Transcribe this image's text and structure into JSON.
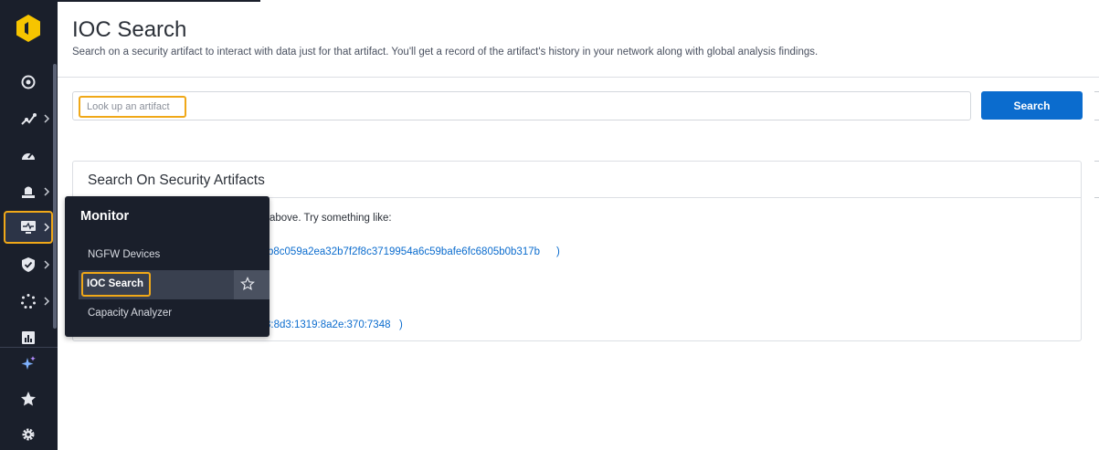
{
  "page": {
    "title": "IOC Search",
    "subtitle": "Search on a security artifact to interact with data just for that artifact. You'll get a record of the artifact's history in your network along with global analysis findings."
  },
  "search": {
    "placeholder": "Look up an artifact",
    "button_label": "Search"
  },
  "card": {
    "title": "Search On Security Artifacts",
    "intro_fragment": "above. Try something like:",
    "hash_fragment": "b8c059a2ea32b7f2f8c3719954a6c59bafe6fc6805b0b317b",
    "hash_close": ")",
    "ipv6_fragment": "3:8d3:1319:8a2e:370:7348",
    "ipv6_close": ")"
  },
  "flyout": {
    "title": "Monitor",
    "items": [
      {
        "label": "NGFW Devices",
        "active": false
      },
      {
        "label": "IOC Search",
        "active": true
      },
      {
        "label": "Capacity Analyzer",
        "active": false
      }
    ]
  },
  "sidebar": {
    "items": [
      {
        "icon": "radar-icon",
        "has_chevron": false
      },
      {
        "icon": "network-analytics-icon",
        "has_chevron": true
      },
      {
        "icon": "dashboard-gauge-icon",
        "has_chevron": false
      },
      {
        "icon": "alarm-bell-icon",
        "has_chevron": true
      },
      {
        "icon": "monitor-icon",
        "has_chevron": true,
        "active": true
      },
      {
        "icon": "shield-check-icon",
        "has_chevron": true
      },
      {
        "icon": "loading-circle-icon",
        "has_chevron": true
      },
      {
        "icon": "report-chart-icon",
        "has_chevron": false
      },
      {
        "icon": "sparkle-ai-icon",
        "has_chevron": false
      },
      {
        "icon": "star-icon",
        "has_chevron": false
      },
      {
        "icon": "gear-icon",
        "has_chevron": false
      }
    ]
  },
  "colors": {
    "sidebar_bg": "#1a1f2b",
    "accent_highlight": "#f0a818",
    "primary_button": "#0b6cce",
    "link": "#0b6cce",
    "logo_yellow": "#f6c400"
  }
}
